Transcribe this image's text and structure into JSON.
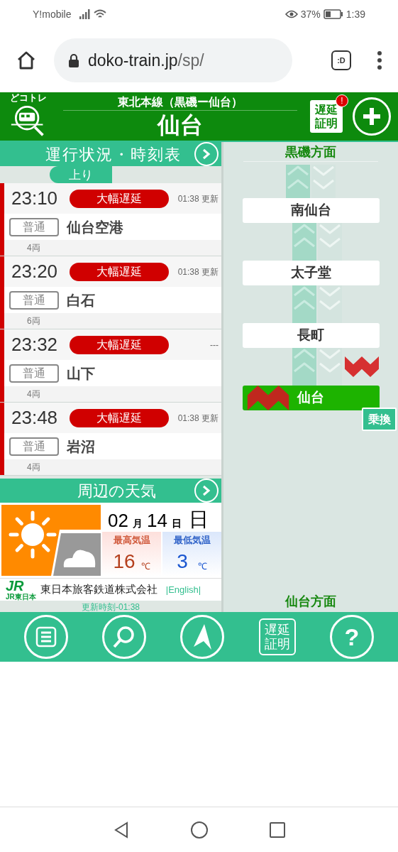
{
  "status_bar": {
    "carrier": "Y!mobile",
    "battery": "37%",
    "time": "1:39"
  },
  "browser": {
    "url_host": "doko-train.jp",
    "url_path": "/sp/",
    "tab_label": ":D"
  },
  "header": {
    "logo_text": "どコトレ",
    "line": "東北本線（黒磯ー仙台）",
    "station": "仙台",
    "cert_lines": [
      "遅延",
      "証明"
    ],
    "cert_alert": "!"
  },
  "timetable": {
    "title": "運行状況・時刻表",
    "directions": [
      {
        "label": "上り",
        "selected": true
      }
    ],
    "trains": [
      {
        "time": "23:10",
        "status": "大幅遅延",
        "updated": "01:38 更新",
        "type": "普通",
        "destination": "仙台空港",
        "cars": "4両"
      },
      {
        "time": "23:20",
        "status": "大幅遅延",
        "updated": "01:38 更新",
        "type": "普通",
        "destination": "白石",
        "cars": "6両"
      },
      {
        "time": "23:32",
        "status": "大幅遅延",
        "updated": "---",
        "type": "普通",
        "destination": "山下",
        "cars": "4両"
      },
      {
        "time": "23:48",
        "status": "大幅遅延",
        "updated": "01:38 更新",
        "type": "普通",
        "destination": "岩沼",
        "cars": "4両"
      }
    ]
  },
  "weather": {
    "title": "周辺の天気",
    "month": "02",
    "month_unit": "月",
    "day": "14",
    "day_unit": "日",
    "weekday": "日",
    "high_label": "最高気温",
    "high": "16",
    "low_label": "最低気温",
    "low": "3",
    "unit": "℃"
  },
  "footer": {
    "jr_mark": "JR",
    "jr_sub": "JR東日本",
    "company": "東日本旅客鉄道株式会社",
    "english_link": "|English|",
    "updated": "更新時刻-01:38"
  },
  "route": {
    "top_direction": "黒磯方面",
    "bottom_direction": "仙台方面",
    "transfer": "乗換",
    "stations": [
      {
        "name": "南仙台",
        "selected": false,
        "train_after": false
      },
      {
        "name": "太子堂",
        "selected": false,
        "train_after": false
      },
      {
        "name": "長町",
        "selected": false,
        "train_after": true
      },
      {
        "name": "仙台",
        "selected": true,
        "train_after": false
      }
    ]
  },
  "bottom_nav": {
    "cert_lines": [
      "遅延",
      "証明"
    ],
    "help": "?"
  }
}
